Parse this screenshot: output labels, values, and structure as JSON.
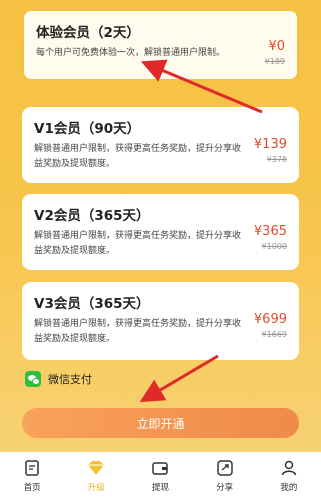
{
  "plans": [
    {
      "name": "体验会员（2天）",
      "desc": "每个用户可免费体验一次，解锁普通用户限制。",
      "price": "¥0",
      "orig": "¥189"
    },
    {
      "name": "V1会员（90天）",
      "desc": "解锁普通用户限制，获得更高任务奖励，提升分享收益奖励及提现额度。",
      "price": "¥139",
      "orig": "¥378"
    },
    {
      "name": "V2会员（365天）",
      "desc": "解锁普通用户限制，获得更高任务奖励，提升分享收益奖励及提现额度。",
      "price": "¥365",
      "orig": "¥1000"
    },
    {
      "name": "V3会员（365天）",
      "desc": "解锁普通用户限制，获得更高任务奖励，提升分享收益奖励及提现额度。",
      "price": "¥699",
      "orig": "¥1669"
    }
  ],
  "payment": {
    "label": "微信支付",
    "icon": "wechat-icon"
  },
  "open_button": "立即开通",
  "tabs": [
    {
      "label": "首页",
      "icon": "home-icon"
    },
    {
      "label": "升级",
      "icon": "diamond-icon",
      "active": true
    },
    {
      "label": "提现",
      "icon": "wallet-icon"
    },
    {
      "label": "分享",
      "icon": "share-icon"
    },
    {
      "label": "我的",
      "icon": "user-icon"
    }
  ],
  "colors": {
    "accent": "#f4c041",
    "price": "#e64a2e",
    "button": "#f08a4a",
    "active_tab": "#f1b31e"
  }
}
